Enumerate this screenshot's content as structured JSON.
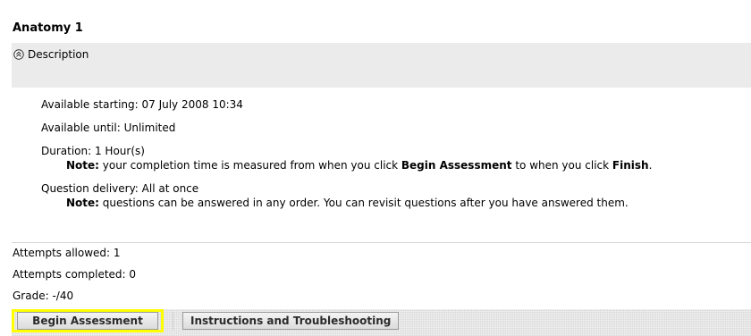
{
  "assessment": {
    "title": "Anatomy 1",
    "description_label": "Description",
    "available_starting": "Available starting: 07 July 2008 10:34",
    "available_until": "Available until: Unlimited",
    "duration": "Duration: 1 Hour(s)",
    "duration_note_label": "Note:",
    "duration_note_pre": " your completion time is measured from when you click ",
    "duration_note_begin": "Begin Assessment",
    "duration_note_mid": " to when you click ",
    "duration_note_finish": "Finish",
    "duration_note_end": ".",
    "question_delivery": "Question delivery: All at once",
    "delivery_note_label": "Note:",
    "delivery_note_text": " questions can be answered in any order. You can revisit questions after you have answered them.",
    "attempts_allowed": "Attempts allowed: 1",
    "attempts_completed": "Attempts completed: 0",
    "grade": "Grade: -/40"
  },
  "actions": {
    "begin_label": "Begin Assessment",
    "instructions_label": "Instructions and Troubleshooting",
    "highlight_color": "#ffff00"
  },
  "icons": {
    "description_toggle": "chevron-up-circle-icon"
  }
}
